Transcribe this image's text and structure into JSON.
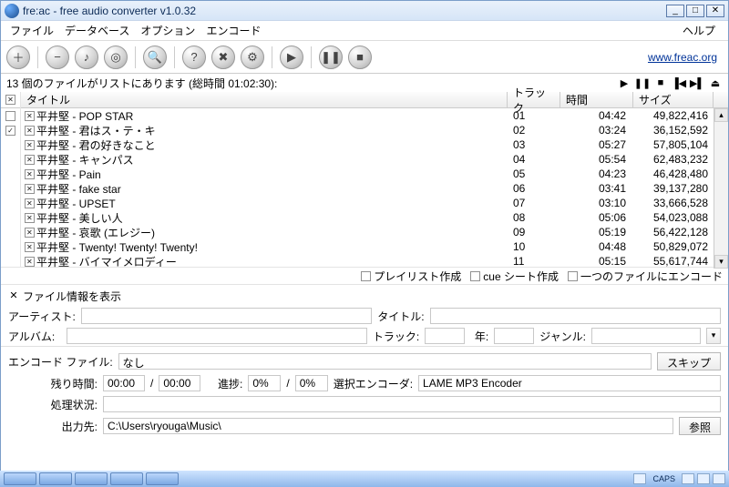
{
  "window": {
    "title": "fre:ac - free audio converter v1.0.32"
  },
  "menu": {
    "file": "ファイル",
    "database": "データベース",
    "options": "オプション",
    "encode": "エンコード",
    "help": "ヘルプ"
  },
  "link": {
    "site": "www.freac.org"
  },
  "status": {
    "text": "13 個のファイルがリストにあります (総時間 01:02:30):"
  },
  "columns": {
    "title": "タイトル",
    "track": "トラック",
    "time": "時間",
    "size": "サイズ"
  },
  "tracks": [
    {
      "title": "平井堅 - POP STAR",
      "track": "01",
      "time": "04:42",
      "size": "49,822,416"
    },
    {
      "title": "平井堅 - 君はス・テ・キ",
      "track": "02",
      "time": "03:24",
      "size": "36,152,592"
    },
    {
      "title": "平井堅 - 君の好きなこと",
      "track": "03",
      "time": "05:27",
      "size": "57,805,104"
    },
    {
      "title": "平井堅 - キャンパス",
      "track": "04",
      "time": "05:54",
      "size": "62,483,232"
    },
    {
      "title": "平井堅 - Pain",
      "track": "05",
      "time": "04:23",
      "size": "46,428,480"
    },
    {
      "title": "平井堅 - fake star",
      "track": "06",
      "time": "03:41",
      "size": "39,137,280"
    },
    {
      "title": "平井堅 - UPSET",
      "track": "07",
      "time": "03:10",
      "size": "33,666,528"
    },
    {
      "title": "平井堅 - 美しい人",
      "track": "08",
      "time": "05:06",
      "size": "54,023,088"
    },
    {
      "title": "平井堅 - 哀歌 (エレジー)",
      "track": "09",
      "time": "05:19",
      "size": "56,422,128"
    },
    {
      "title": "平井堅 - Twenty! Twenty! Twenty!",
      "track": "10",
      "time": "04:48",
      "size": "50,829,072"
    },
    {
      "title": "平井堅 - バイマイメロディー",
      "track": "11",
      "time": "05:15",
      "size": "55,617,744"
    }
  ],
  "underlist": {
    "playlist": "プレイリスト作成",
    "cue": "cue シート作成",
    "single": "一つのファイルにエンコード"
  },
  "info": {
    "header": "ファイル情報を表示",
    "artist_lbl": "アーティスト:",
    "artist": "",
    "title_lbl": "タイトル:",
    "title": "",
    "album_lbl": "アルバム:",
    "album": "",
    "track_lbl": "トラック:",
    "track": "",
    "year_lbl": "年:",
    "year": "",
    "genre_lbl": "ジャンル:",
    "genre": ""
  },
  "enc": {
    "file_lbl": "エンコード ファイル:",
    "file": "なし",
    "skip": "スキップ",
    "remain_lbl": "残り時間:",
    "remain1": "00:00",
    "remain2": "00:00",
    "progress_lbl": "進捗:",
    "progress1": "0%",
    "progress2": "0%",
    "encoder_lbl": "選択エンコーダ:",
    "encoder": "LAME MP3 Encoder",
    "status_lbl": "処理状況:",
    "status": "",
    "out_lbl": "出力先:",
    "out": "C:\\Users\\ryouga\\Music\\",
    "browse": "参照"
  },
  "tray": {
    "caps": "CAPS"
  }
}
